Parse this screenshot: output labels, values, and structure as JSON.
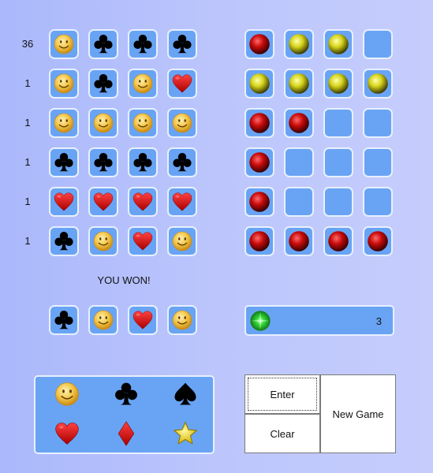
{
  "rows": [
    {
      "count": "36",
      "guess": [
        "smiley",
        "club",
        "club",
        "club"
      ],
      "feedback": [
        "red",
        "yellow",
        "yellow",
        "empty"
      ]
    },
    {
      "count": "1",
      "guess": [
        "smiley",
        "club",
        "smiley",
        "heart"
      ],
      "feedback": [
        "yellow",
        "yellow",
        "yellow",
        "yellow"
      ]
    },
    {
      "count": "1",
      "guess": [
        "smiley",
        "smiley",
        "smiley",
        "smiley"
      ],
      "feedback": [
        "red",
        "red",
        "empty",
        "empty"
      ]
    },
    {
      "count": "1",
      "guess": [
        "club",
        "club",
        "club",
        "club"
      ],
      "feedback": [
        "red",
        "empty",
        "empty",
        "empty"
      ]
    },
    {
      "count": "1",
      "guess": [
        "heart",
        "heart",
        "heart",
        "heart"
      ],
      "feedback": [
        "red",
        "empty",
        "empty",
        "empty"
      ]
    },
    {
      "count": "1",
      "guess": [
        "club",
        "smiley",
        "heart",
        "smiley"
      ],
      "feedback": [
        "red",
        "red",
        "red",
        "red"
      ]
    }
  ],
  "message": "YOU WON!",
  "solution": [
    "club",
    "smiley",
    "heart",
    "smiley"
  ],
  "status_value": "3",
  "palette": [
    "smiley",
    "club",
    "spade",
    "heart",
    "diamond",
    "star"
  ],
  "buttons": {
    "enter": "Enter",
    "clear": "Clear",
    "new_game": "New Game"
  },
  "colors": {
    "tile": "#69a4f4",
    "tile_border": "#e8f0ff",
    "background": "#b6c1fc"
  }
}
